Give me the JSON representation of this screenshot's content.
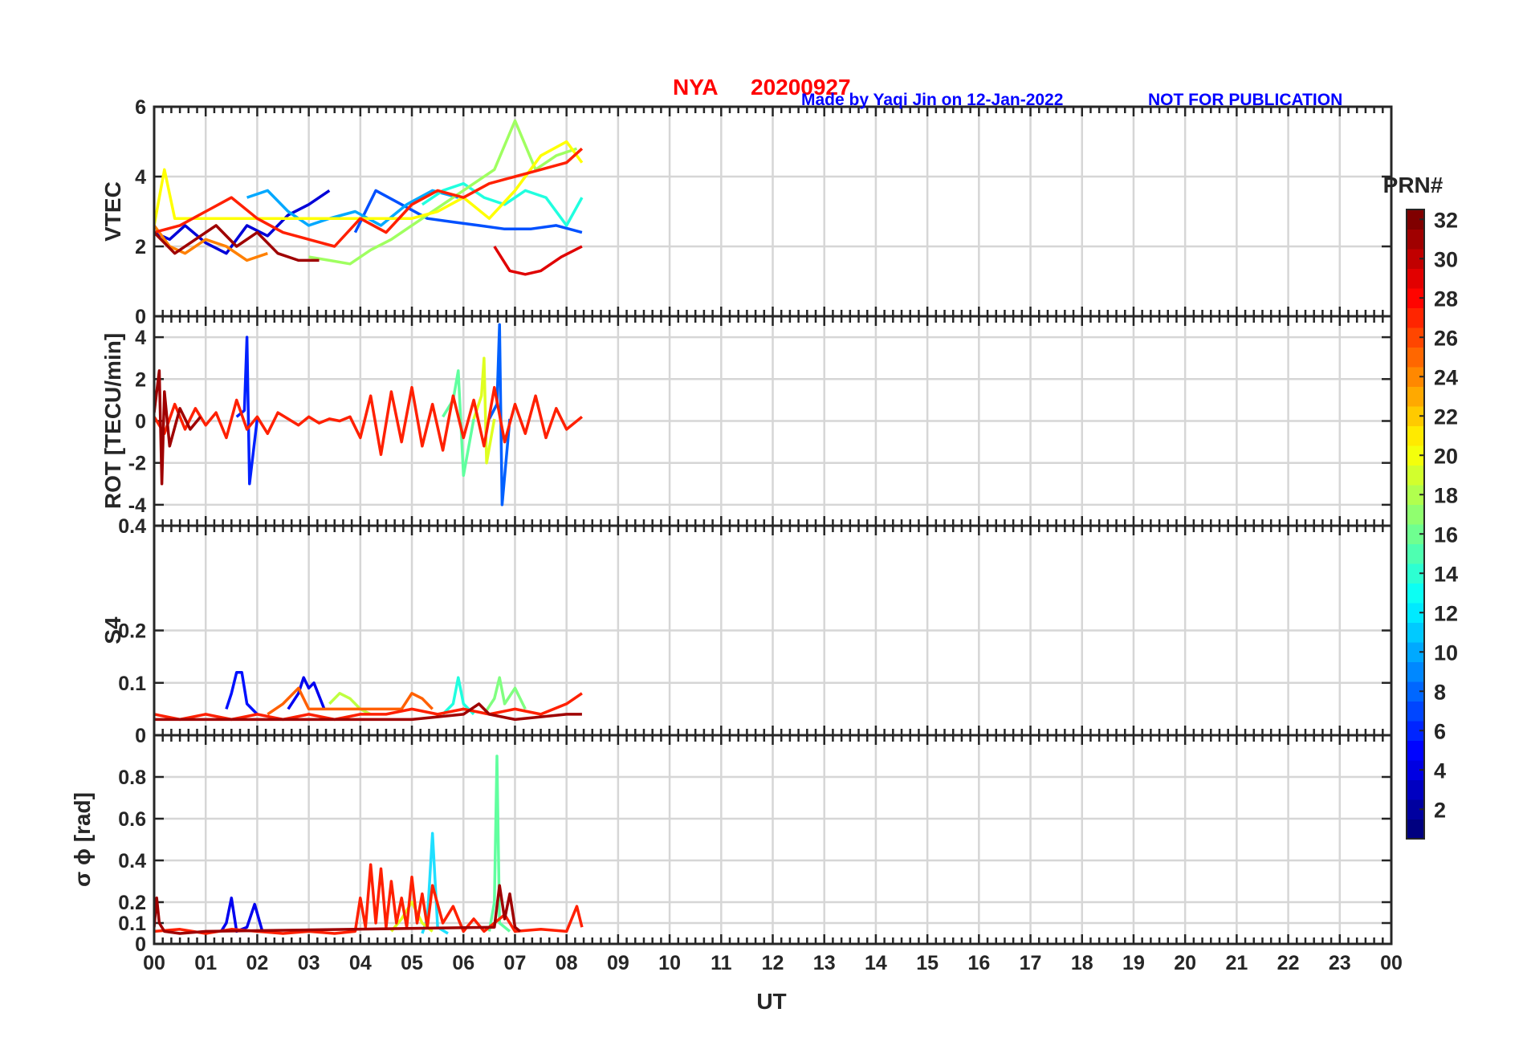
{
  "header": {
    "station": "NYA",
    "date": "20200927",
    "credit": "Made by Yaqi Jin on 12-Jan-2022",
    "notice": "NOT FOR PUBLICATION"
  },
  "colorbar": {
    "title": "PRN#",
    "range": [
      1,
      32
    ],
    "ticks": [
      "2",
      "4",
      "6",
      "8",
      "10",
      "12",
      "14",
      "16",
      "18",
      "20",
      "22",
      "24",
      "26",
      "28",
      "30",
      "32"
    ],
    "colormap": "jet"
  },
  "xaxis": {
    "label": "UT",
    "range": [
      0,
      24
    ],
    "ticks": [
      "00",
      "01",
      "02",
      "03",
      "04",
      "05",
      "06",
      "07",
      "08",
      "09",
      "10",
      "11",
      "12",
      "13",
      "14",
      "15",
      "16",
      "17",
      "18",
      "19",
      "20",
      "21",
      "22",
      "23",
      "00"
    ]
  },
  "colors": {
    "grid": "#d6d6d6",
    "axis": "#262626",
    "title": "#ff0000",
    "note": "#0000ff"
  },
  "chart_data": [
    {
      "type": "line",
      "ylabel": "VTEC",
      "ylim": [
        0,
        6
      ],
      "yticks": [
        "0",
        "2",
        "4",
        "6"
      ],
      "grid": true,
      "series": [
        {
          "prn": 2,
          "color": "#0000d8",
          "x": [
            0,
            0.3,
            0.6,
            1.0,
            1.4,
            1.8,
            2.2,
            2.6,
            3.0,
            3.4
          ],
          "y": [
            2.4,
            2.2,
            2.6,
            2.1,
            1.8,
            2.6,
            2.3,
            2.9,
            3.2,
            3.6
          ]
        },
        {
          "prn": 6,
          "color": "#0050ff",
          "x": [
            3.9,
            4.3,
            4.8,
            5.3,
            5.8,
            6.3,
            6.8,
            7.3,
            7.8,
            8.3
          ],
          "y": [
            2.4,
            3.6,
            3.2,
            2.8,
            2.7,
            2.6,
            2.5,
            2.5,
            2.6,
            2.4
          ]
        },
        {
          "prn": 10,
          "color": "#00a8ff",
          "x": [
            1.8,
            2.2,
            2.6,
            3.0,
            3.4,
            3.9,
            4.4,
            4.9,
            5.4,
            5.9
          ],
          "y": [
            3.4,
            3.6,
            3.0,
            2.6,
            2.8,
            3.0,
            2.6,
            3.2,
            3.6,
            3.4
          ]
        },
        {
          "prn": 13,
          "color": "#20ffdf",
          "x": [
            5.2,
            5.6,
            6.0,
            6.4,
            6.8,
            7.2,
            7.6,
            8.0,
            8.3
          ],
          "y": [
            3.2,
            3.6,
            3.8,
            3.4,
            3.2,
            3.6,
            3.4,
            2.6,
            3.4
          ]
        },
        {
          "prn": 17,
          "color": "#9fff60",
          "x": [
            3.0,
            3.4,
            3.8,
            4.2,
            4.6,
            5.0,
            5.4,
            5.8,
            6.2,
            6.6,
            7.0,
            7.4,
            7.8,
            8.2
          ],
          "y": [
            1.7,
            1.6,
            1.5,
            1.9,
            2.2,
            2.6,
            3.0,
            3.4,
            3.8,
            4.2,
            5.6,
            4.2,
            4.6,
            4.8
          ]
        },
        {
          "prn": 20,
          "color": "#ffff00",
          "x": [
            0,
            0.2,
            0.4,
            5.0,
            5.5,
            6.0,
            6.5,
            7.0,
            7.5,
            8.0,
            8.3
          ],
          "y": [
            2.6,
            4.2,
            2.8,
            2.8,
            3.0,
            3.4,
            2.8,
            3.6,
            4.6,
            5.0,
            4.4
          ]
        },
        {
          "prn": 24,
          "color": "#ff8000",
          "x": [
            0,
            0.3,
            0.6,
            1.0,
            1.4,
            1.8,
            2.2
          ],
          "y": [
            2.6,
            2.0,
            1.8,
            2.2,
            2.0,
            1.6,
            1.8
          ]
        },
        {
          "prn": 27,
          "color": "#ff2000",
          "x": [
            0,
            0.5,
            1.0,
            1.5,
            2.0,
            2.5,
            3.0,
            3.5,
            4.0,
            4.5,
            5.0,
            5.5,
            6.0,
            6.5,
            7.0,
            7.5,
            8.0,
            8.3
          ],
          "y": [
            2.4,
            2.6,
            3.0,
            3.4,
            2.8,
            2.4,
            2.2,
            2.0,
            2.8,
            2.4,
            3.2,
            3.6,
            3.4,
            3.8,
            4.0,
            4.2,
            4.4,
            4.8
          ]
        },
        {
          "prn": 29,
          "color": "#e00000",
          "x": [
            6.6,
            6.9,
            7.2,
            7.5,
            7.9,
            8.3
          ],
          "y": [
            2.0,
            1.3,
            1.2,
            1.3,
            1.7,
            2.0
          ]
        },
        {
          "prn": 31,
          "color": "#9f0000",
          "x": [
            0,
            0.4,
            0.8,
            1.2,
            1.6,
            2.0,
            2.4,
            2.8,
            3.2
          ],
          "y": [
            2.4,
            1.8,
            2.2,
            2.6,
            2.0,
            2.4,
            1.8,
            1.6,
            1.6
          ]
        }
      ]
    },
    {
      "type": "line",
      "ylabel": "ROT [TECU/min]",
      "ylim": [
        -5,
        5
      ],
      "yticks": [
        "-4",
        "-2",
        "0",
        "2",
        "4"
      ],
      "grid": true,
      "series": [
        {
          "prn": 5,
          "color": "#0020ff",
          "x": [
            1.6,
            1.75,
            1.8,
            1.85,
            2.0
          ],
          "y": [
            0.2,
            0.5,
            4.0,
            -3.0,
            0.1
          ]
        },
        {
          "prn": 7,
          "color": "#0060ff",
          "x": [
            6.5,
            6.65,
            6.7,
            6.75,
            6.9
          ],
          "y": [
            0.1,
            0.8,
            4.6,
            -4.0,
            0.1
          ]
        },
        {
          "prn": 15,
          "color": "#60ff9f",
          "x": [
            5.6,
            5.8,
            5.9,
            6.0,
            6.2
          ],
          "y": [
            0.2,
            1.0,
            2.4,
            -2.6,
            0.1
          ]
        },
        {
          "prn": 19,
          "color": "#dfff20",
          "x": [
            6.2,
            6.35,
            6.4,
            6.45,
            6.6
          ],
          "y": [
            0.1,
            1.2,
            3.0,
            -2.0,
            0.1
          ]
        },
        {
          "prn": 27,
          "color": "#ff2000",
          "x": [
            0,
            0.2,
            0.4,
            0.6,
            0.8,
            1.0,
            1.2,
            1.4,
            1.6,
            1.8,
            2.0,
            2.2,
            2.4,
            2.6,
            2.8,
            3.0,
            3.2,
            3.4,
            3.6,
            3.8,
            4.0,
            4.2,
            4.4,
            4.6,
            4.8,
            5.0,
            5.2,
            5.4,
            5.6,
            5.8,
            6.0,
            6.2,
            6.4,
            6.6,
            6.8,
            7.0,
            7.2,
            7.4,
            7.6,
            7.8,
            8.0,
            8.3
          ],
          "y": [
            0.2,
            -0.6,
            0.8,
            -0.4,
            0.6,
            -0.2,
            0.4,
            -0.8,
            1.0,
            -0.4,
            0.2,
            -0.6,
            0.4,
            0.1,
            -0.2,
            0.2,
            -0.1,
            0.1,
            0.0,
            0.2,
            -0.8,
            1.2,
            -1.6,
            1.4,
            -1.0,
            1.6,
            -1.2,
            0.8,
            -1.4,
            1.2,
            -0.8,
            1.0,
            -1.2,
            1.6,
            -1.0,
            0.8,
            -0.6,
            1.2,
            -0.8,
            0.6,
            -0.4,
            0.2
          ]
        },
        {
          "prn": 31,
          "color": "#9f0000",
          "x": [
            0,
            0.1,
            0.15,
            0.2,
            0.3,
            0.5,
            0.7,
            0.9
          ],
          "y": [
            0.4,
            2.4,
            -3.0,
            1.4,
            -1.2,
            0.6,
            -0.4,
            0.2
          ]
        }
      ]
    },
    {
      "type": "line",
      "ylabel": "S4",
      "ylim": [
        0,
        0.4
      ],
      "yticks": [
        "0",
        "0.1",
        "0.2",
        "0.4"
      ],
      "grid": true,
      "series": [
        {
          "prn": 4,
          "color": "#0010ff",
          "x": [
            1.4,
            1.5,
            1.6,
            1.7,
            1.8,
            2.0
          ],
          "y": [
            0.05,
            0.08,
            0.12,
            0.12,
            0.06,
            0.04
          ]
        },
        {
          "prn": 3,
          "color": "#0000f0",
          "x": [
            2.6,
            2.8,
            2.9,
            3.0,
            3.1,
            3.3
          ],
          "y": [
            0.05,
            0.08,
            0.11,
            0.09,
            0.1,
            0.05
          ]
        },
        {
          "prn": 13,
          "color": "#20ffdf",
          "x": [
            5.6,
            5.8,
            5.9,
            6.0,
            6.2
          ],
          "y": [
            0.04,
            0.06,
            0.11,
            0.06,
            0.04
          ]
        },
        {
          "prn": 16,
          "color": "#80ff80",
          "x": [
            6.4,
            6.6,
            6.7,
            6.8,
            7.0,
            7.2
          ],
          "y": [
            0.04,
            0.07,
            0.11,
            0.06,
            0.09,
            0.05
          ]
        },
        {
          "prn": 18,
          "color": "#bfff40",
          "x": [
            3.4,
            3.6,
            3.8,
            4.0,
            4.2
          ],
          "y": [
            0.06,
            0.08,
            0.07,
            0.05,
            0.04
          ]
        },
        {
          "prn": 25,
          "color": "#ff6000",
          "x": [
            2.2,
            2.5,
            2.8,
            3.0,
            4.8,
            5.0,
            5.2,
            5.4
          ],
          "y": [
            0.04,
            0.06,
            0.09,
            0.05,
            0.05,
            0.08,
            0.07,
            0.05
          ]
        },
        {
          "prn": 27,
          "color": "#ff2000",
          "x": [
            0,
            0.5,
            1.0,
            1.5,
            2.0,
            2.5,
            3.0,
            3.5,
            4.0,
            4.5,
            5.0,
            5.5,
            6.0,
            6.5,
            7.0,
            7.5,
            8.0,
            8.3
          ],
          "y": [
            0.04,
            0.03,
            0.04,
            0.03,
            0.04,
            0.03,
            0.04,
            0.03,
            0.04,
            0.04,
            0.05,
            0.04,
            0.05,
            0.04,
            0.05,
            0.04,
            0.06,
            0.08
          ]
        },
        {
          "prn": 31,
          "color": "#9f0000",
          "x": [
            0,
            1.0,
            2.0,
            3.0,
            4.0,
            5.0,
            6.0,
            6.3,
            6.5,
            7.0,
            8.0,
            8.3
          ],
          "y": [
            0.03,
            0.03,
            0.03,
            0.03,
            0.03,
            0.03,
            0.04,
            0.06,
            0.04,
            0.03,
            0.04,
            0.04
          ]
        }
      ]
    },
    {
      "type": "line",
      "ylabel": "σ ϕ [rad]",
      "ylim": [
        0,
        1.0
      ],
      "yticks": [
        "0",
        "0.1",
        "0.2",
        "0.4",
        "0.6",
        "0.8"
      ],
      "grid": true,
      "series": [
        {
          "prn": 3,
          "color": "#0000f0",
          "x": [
            1.3,
            1.4,
            1.5,
            1.6,
            1.8,
            1.95,
            2.1
          ],
          "y": [
            0.06,
            0.1,
            0.22,
            0.06,
            0.08,
            0.19,
            0.06
          ]
        },
        {
          "prn": 12,
          "color": "#20dfff",
          "x": [
            5.2,
            5.3,
            5.4,
            5.5,
            5.7
          ],
          "y": [
            0.05,
            0.12,
            0.53,
            0.08,
            0.05
          ]
        },
        {
          "prn": 15,
          "color": "#60ff9f",
          "x": [
            6.5,
            6.6,
            6.65,
            6.7,
            6.9
          ],
          "y": [
            0.06,
            0.2,
            0.9,
            0.1,
            0.06
          ]
        },
        {
          "prn": 19,
          "color": "#dfff20",
          "x": [
            4.6,
            4.8,
            5.0,
            5.2,
            5.4
          ],
          "y": [
            0.06,
            0.12,
            0.2,
            0.1,
            0.06
          ]
        },
        {
          "prn": 27,
          "color": "#ff2000",
          "x": [
            0,
            0.5,
            1.0,
            1.5,
            2.0,
            2.5,
            3.0,
            3.5,
            3.9,
            4.0,
            4.1,
            4.2,
            4.3,
            4.4,
            4.5,
            4.6,
            4.7,
            4.8,
            4.9,
            5.0,
            5.1,
            5.2,
            5.3,
            5.4,
            5.6,
            5.8,
            6.0,
            6.2,
            6.4,
            6.6,
            6.8,
            7.0,
            7.5,
            8.0,
            8.2,
            8.3
          ],
          "y": [
            0.06,
            0.07,
            0.05,
            0.07,
            0.06,
            0.05,
            0.06,
            0.05,
            0.06,
            0.22,
            0.08,
            0.38,
            0.1,
            0.36,
            0.08,
            0.3,
            0.1,
            0.22,
            0.08,
            0.32,
            0.1,
            0.24,
            0.08,
            0.28,
            0.1,
            0.18,
            0.06,
            0.12,
            0.06,
            0.1,
            0.14,
            0.06,
            0.07,
            0.06,
            0.18,
            0.08
          ]
        },
        {
          "prn": 31,
          "color": "#9f0000",
          "x": [
            0,
            0.05,
            0.1,
            0.2,
            0.5,
            1.0,
            6.6,
            6.7,
            6.8,
            6.9,
            7.0,
            7.1
          ],
          "y": [
            0.08,
            0.22,
            0.1,
            0.06,
            0.05,
            0.06,
            0.08,
            0.28,
            0.12,
            0.24,
            0.08,
            0.06
          ]
        }
      ]
    }
  ]
}
